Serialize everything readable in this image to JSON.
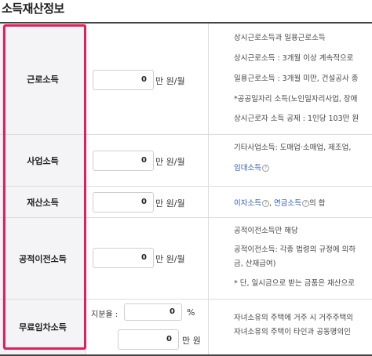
{
  "page_title": "소득재산정보",
  "rows": [
    {
      "label": "근로소득",
      "input_value": "0",
      "unit": "만 원/월",
      "desc": [
        "상시근로소득과 일용근로소득",
        "상시근로소득 : 3개월 이상 계속적으로",
        "일용근로소득 : 3개월 미만, 건설공사 종",
        "*공공일자리 소득(노인일자리사업, 장애",
        "상시근로자 소득 공제 : 1인당 103만 원"
      ]
    },
    {
      "label": "사업소득",
      "input_value": "0",
      "unit": "만 원/월",
      "desc": [
        "기타사업소득: 도매업·소매업, 제조업,"
      ],
      "link": "임대소득"
    },
    {
      "label": "재산소득",
      "input_value": "0",
      "unit": "만 원/월",
      "link1": "이자소득",
      "link2": "연금소득",
      "suffix": "의 합"
    },
    {
      "label": "공적이전소득",
      "input_value": "0",
      "unit": "만 원/월",
      "desc": [
        "공적이전소득만 해당",
        "공적이전소득: 각종 법령의 규정에 의하",
        "금, 산재급여)",
        "* 단, 일시금으로 받는 금품은 재산으로"
      ]
    },
    {
      "label": "무료임차소득",
      "share_label": "지분율 :",
      "share_value": "0",
      "share_unit": "%",
      "input_value": "0",
      "unit": "만 원",
      "desc": [
        "자녀소유의 주택에 거주 시 거주주택의",
        "자녀소유의 주택이 타인과 공동명의인"
      ]
    }
  ],
  "help_icon_glyph": "?",
  "highlight_color": "#e21e5a",
  "link_color": "#2a58b8"
}
